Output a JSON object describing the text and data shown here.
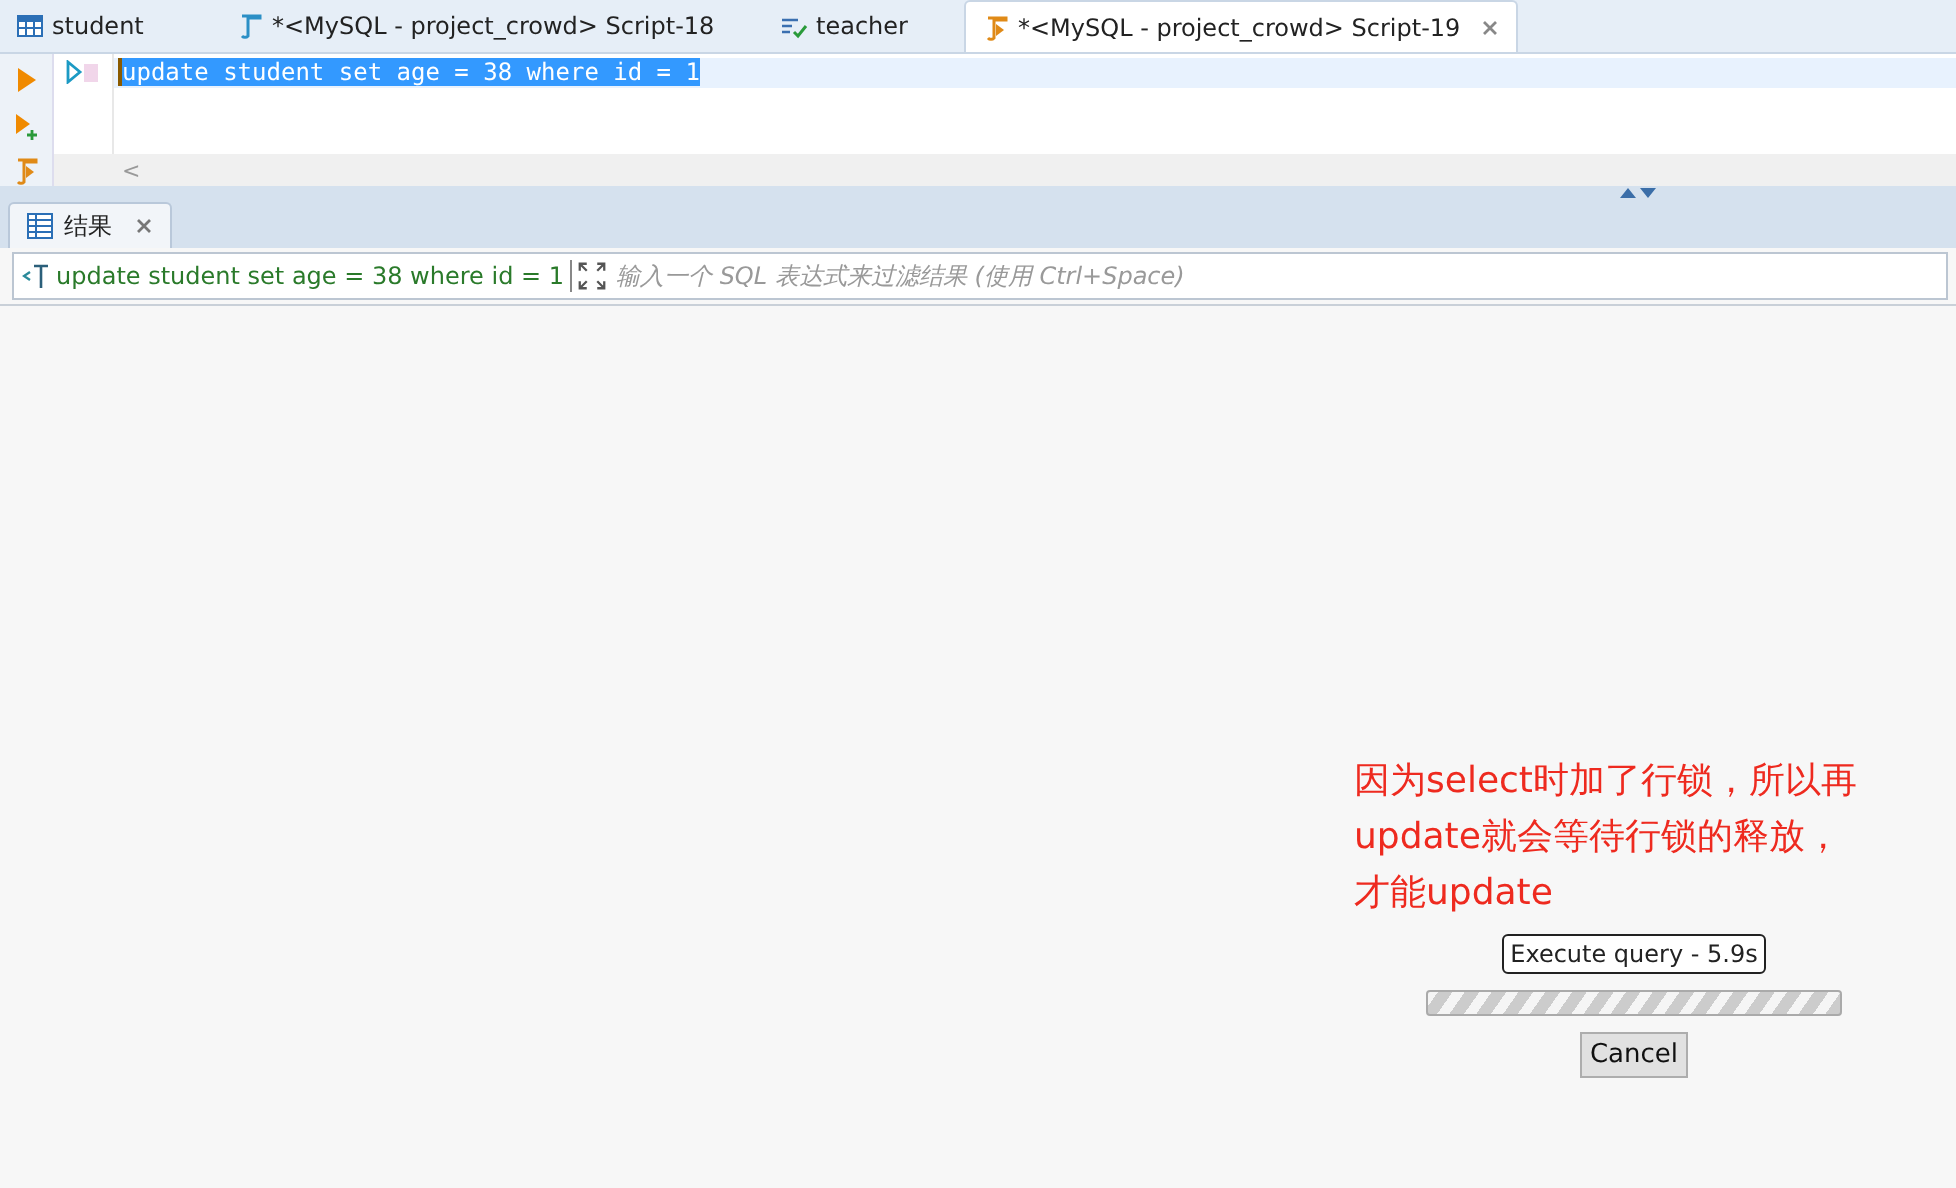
{
  "editor_tabs": [
    {
      "label": "student",
      "kind": "table",
      "selected": false
    },
    {
      "label": "*<MySQL - project_crowd> Script-18",
      "kind": "script",
      "selected": false
    },
    {
      "label": "teacher",
      "kind": "view",
      "selected": false
    },
    {
      "label": "*<MySQL - project_crowd> Script-19",
      "kind": "active-script",
      "selected": true
    }
  ],
  "editor": {
    "lines": [
      "update student set age = 38 where id = 1"
    ],
    "scroll_left": "<"
  },
  "results_tab": {
    "label": "结果",
    "selected": true
  },
  "filter": {
    "query": "update student set age = 38 where id = 1",
    "placeholder": "输入一个 SQL 表达式来过滤结果 (使用 Ctrl+Space)"
  },
  "annotation": "因为select时加了行锁，所以再update就会等待行锁的释放，才能update",
  "progress": {
    "label": "Execute query - 5.9s",
    "indeterminate": true,
    "cancel": "Cancel"
  }
}
